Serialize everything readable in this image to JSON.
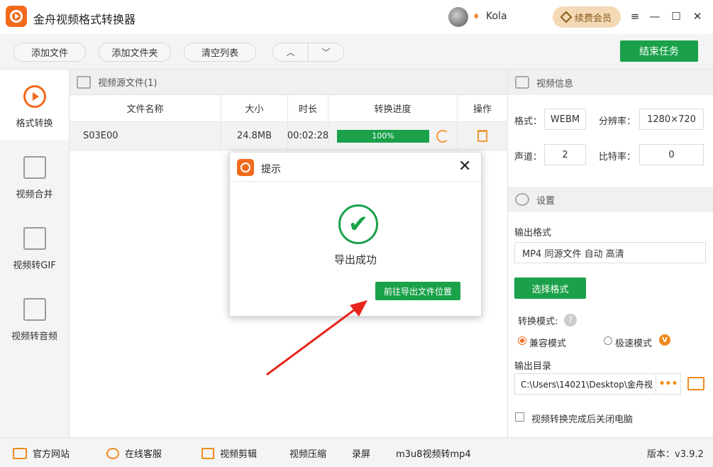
{
  "app": {
    "title": "金舟视频格式转换器",
    "username": "Kola",
    "renew_label": "续费会员",
    "accent_color": "#f26a1b",
    "green_color": "#1aa14a"
  },
  "window_controls": {
    "menu": "≡",
    "minimize": "—",
    "maximize": "☐",
    "close": "✕"
  },
  "toolbar": {
    "add_file": "添加文件",
    "add_folder": "添加文件夹",
    "clear_list": "清空列表",
    "up": "︿",
    "down": "﹀",
    "end_task": "结束任务"
  },
  "sidebar": {
    "items": [
      {
        "label": "格式转换",
        "icon": "convert-icon",
        "active": true
      },
      {
        "label": "视频合并",
        "icon": "merge-icon"
      },
      {
        "label": "视频转GIF",
        "icon": "gif-icon"
      },
      {
        "label": "视频转音频",
        "icon": "audio-icon"
      }
    ]
  },
  "file_panel": {
    "header": "视频源文件(1)",
    "columns": [
      "文件名称",
      "大小",
      "时长",
      "转换进度",
      "操作"
    ],
    "rows": [
      {
        "name": "S03E00",
        "size": "24.8MB",
        "duration": "00:02:28",
        "progress": 100,
        "progress_text": "100%"
      }
    ]
  },
  "dialog": {
    "title": "提示",
    "close": "✕",
    "check": "✔",
    "message": "导出成功",
    "button": "前往导出文件位置"
  },
  "video_info": {
    "header": "视频信息",
    "format_label": "格式：",
    "format_value": "WEBM",
    "resolution_label": "分辨率：",
    "resolution_value": "1280×720",
    "channels_label": "声道：",
    "channels_value": "2",
    "bitrate_label": "比特率：",
    "bitrate_value": "0"
  },
  "settings": {
    "header": "设置",
    "output_format_label": "输出格式",
    "output_format_value": "MP4 同源文件 自动 高清",
    "select_format": "选择格式",
    "mode_label": "转换模式:",
    "help": "?",
    "mode_compatible": "兼容模式",
    "mode_fast": "极速模式",
    "vip_badge": "V",
    "output_dir_label": "输出目录",
    "output_dir_value": "C:\\Users\\14021\\Desktop\\金舟视",
    "browse": "•••",
    "shutdown_label": "视频转换完成后关闭电脑"
  },
  "bottombar": {
    "official_site": "官方网站",
    "online_service": "在线客服",
    "video_edit": "视频剪辑",
    "video_compress": "视频压缩",
    "record": "录屏",
    "m3u8": "m3u8视频转mp4",
    "version": "版本：v3.9.2"
  }
}
